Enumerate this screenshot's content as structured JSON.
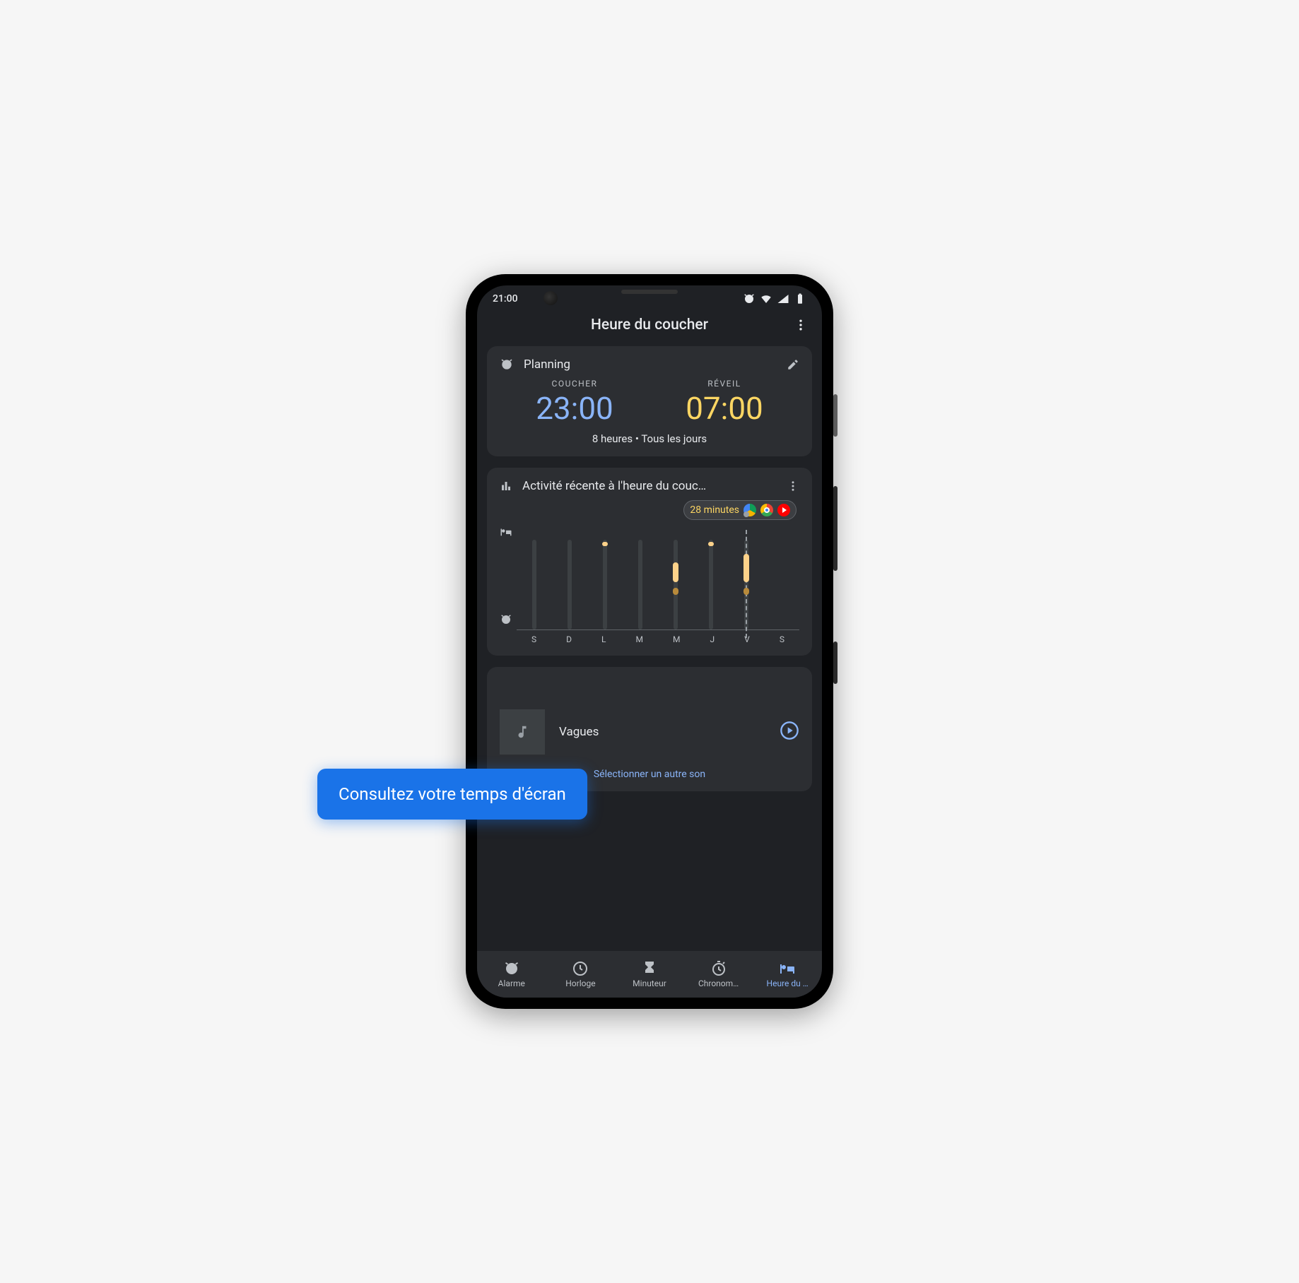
{
  "status": {
    "time": "21:00"
  },
  "header": {
    "title": "Heure du coucher"
  },
  "planning": {
    "title": "Planning",
    "bedtime_label": "COUCHER",
    "bedtime": "23:00",
    "wake_label": "RÉVEIL",
    "wake": "07:00",
    "summary": "8 heures • Tous les jours"
  },
  "activity": {
    "title": "Activité récente à l'heure du couc…",
    "badge_text": "28 minutes",
    "apps": [
      "drive",
      "chrome",
      "youtube"
    ],
    "days": [
      "S",
      "D",
      "L",
      "M",
      "M",
      "J",
      "V",
      "S"
    ]
  },
  "chart_data": {
    "type": "bar",
    "title": "Activité récente à l'heure du coucher",
    "xlabel": "",
    "ylabel": "",
    "ylim": [
      0,
      100
    ],
    "categories": [
      "S",
      "D",
      "L",
      "M",
      "M",
      "J",
      "V",
      "S"
    ],
    "series": [
      {
        "name": "track",
        "values": [
          85,
          85,
          85,
          85,
          85,
          85,
          85,
          0
        ],
        "color": "#3c4043"
      },
      {
        "name": "usage",
        "values": [
          0,
          0,
          2,
          0,
          14,
          2,
          20,
          0
        ],
        "color": "#fdd28a"
      }
    ],
    "today_index": 6,
    "badge": {
      "text": "28 minutes",
      "apps": [
        "drive",
        "chrome",
        "youtube"
      ]
    }
  },
  "sound": {
    "name": "Vagues",
    "other_link": "Sélectionner un autre son"
  },
  "nav": {
    "items": [
      {
        "label": "Alarme",
        "icon": "alarm"
      },
      {
        "label": "Horloge",
        "icon": "clock"
      },
      {
        "label": "Minuteur",
        "icon": "hourglass"
      },
      {
        "label": "Chronom…",
        "icon": "stopwatch"
      },
      {
        "label": "Heure du …",
        "icon": "bed"
      }
    ],
    "active": 4
  },
  "callout": "Consultez votre temps d'écran",
  "colors": {
    "accent": "#8ab4f8",
    "bed": "#8ab4f8",
    "wake": "#fdd663",
    "card": "#2c2e32",
    "bg": "#1f2125"
  }
}
